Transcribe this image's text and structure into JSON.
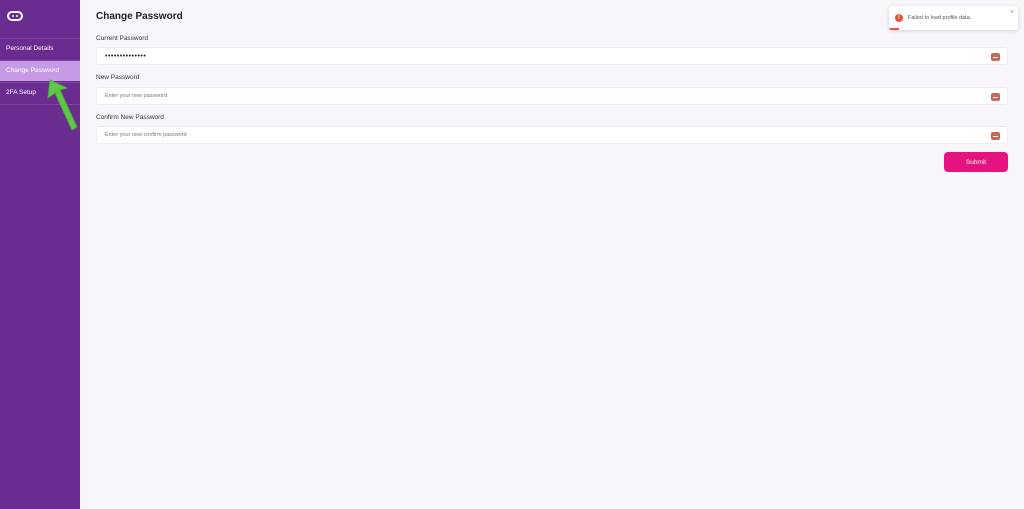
{
  "sidebar": {
    "items": [
      {
        "label": "Personal Details"
      },
      {
        "label": "Change Password",
        "active": true
      },
      {
        "label": "2FA Setup"
      }
    ]
  },
  "page": {
    "title": "Change Password"
  },
  "form": {
    "current_password": {
      "label": "Current Password",
      "value": "••••••••••••••",
      "placeholder": ""
    },
    "new_password": {
      "label": "New Password",
      "value": "",
      "placeholder": "Enter your new password"
    },
    "confirm_password": {
      "label": "Confirm New Password",
      "value": "",
      "placeholder": "Enter your new confirm password"
    },
    "submit_label": "Submit"
  },
  "toast": {
    "message": "Failed to load profile data.",
    "icon": "!",
    "close": "×"
  },
  "colors": {
    "sidebar": "#6a2c91",
    "active_item": "#c79ae6",
    "accent": "#e6127f",
    "error": "#e0533f",
    "annotation_arrow": "#5fc64a"
  },
  "icons": {
    "logo": "logo-icon",
    "password_toggle": "eye-icon",
    "toast_status": "error-icon",
    "annotation": "arrow-icon"
  }
}
